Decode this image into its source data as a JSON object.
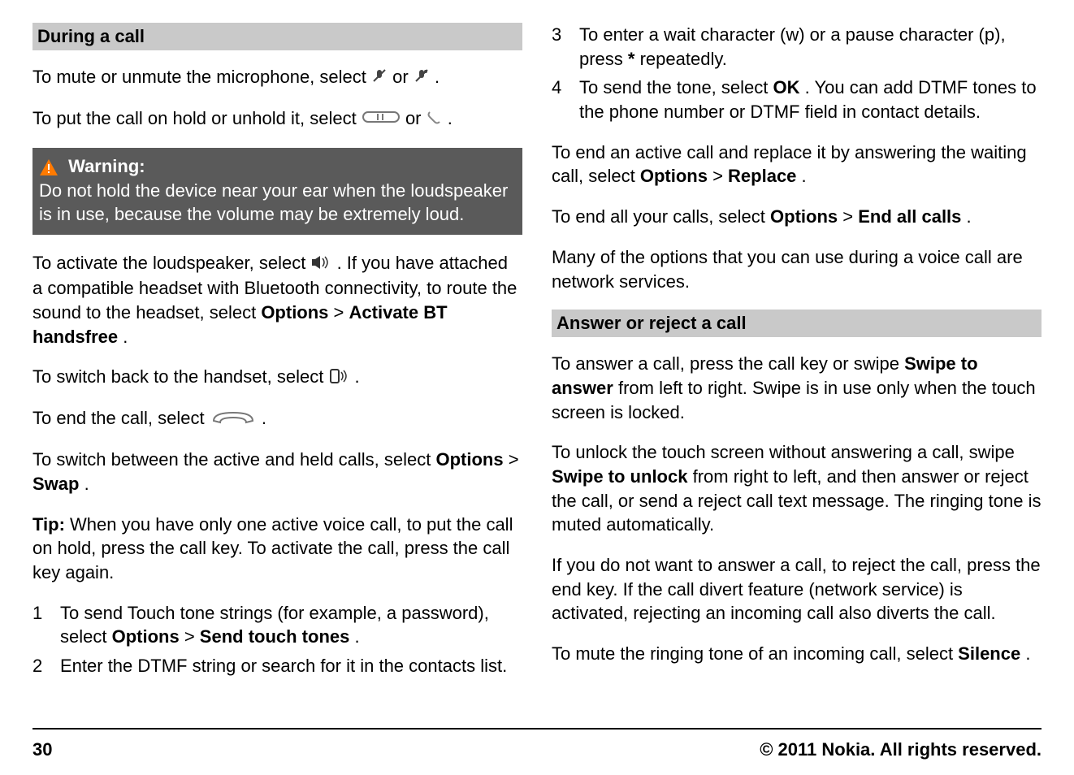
{
  "left": {
    "section_title": "During a call",
    "p1_a": "To mute or unmute the microphone, select ",
    "p1_or": " or ",
    "p1_end": ".",
    "p2_a": "To put the call on hold or unhold it, select ",
    "p2_or": " or ",
    "p2_end": ".",
    "warning_label": "Warning:",
    "warning_text": "Do not hold the device near your ear when the loudspeaker is in use, because the volume may be extremely loud.",
    "p3_a": "To activate the loudspeaker, select ",
    "p3_b": ". If you have attached a compatible headset with Bluetooth connectivity, to route the sound to the headset, select ",
    "p3_opt": "Options",
    "p3_gt": " > ",
    "p3_opt2": "Activate BT handsfree",
    "p3_end": ".",
    "p4_a": "To switch back to the handset, select ",
    "p4_end": ".",
    "p5_a": "To end the call, select ",
    "p5_end": ".",
    "p6_a": "To switch between the active and held calls, select ",
    "p6_opt": "Options",
    "p6_gt": " > ",
    "p6_opt2": "Swap",
    "p6_end": ".",
    "tip_label": "Tip: ",
    "tip_text": "When you have only one active voice call, to put the call on hold, press the call key. To activate the call, press the call key again.",
    "list": [
      {
        "n": "1",
        "a": "To send Touch tone strings (for example, a password), select ",
        "opt": "Options",
        "gt": " > ",
        "opt2": "Send touch tones",
        "end": "."
      },
      {
        "n": "2",
        "a": "Enter the DTMF string or search for it in the contacts list."
      }
    ]
  },
  "right": {
    "list": [
      {
        "n": "3",
        "a": "To enter a wait character (w) or a pause character (p), press ",
        "bold": "*",
        "end": " repeatedly."
      },
      {
        "n": "4",
        "a": "To send the tone, select ",
        "bold": "OK",
        "end": ". You can add DTMF tones to the phone number or DTMF field in contact details."
      }
    ],
    "p1_a": "To end an active call and replace it by answering the waiting call, select ",
    "p1_opt": "Options",
    "p1_gt": " > ",
    "p1_opt2": "Replace",
    "p1_end": ".",
    "p2_a": "To end all your calls, select ",
    "p2_opt": "Options",
    "p2_gt": " > ",
    "p2_opt2": "End all calls",
    "p2_end": ".",
    "p3": "Many of the options that you can use during a voice call are network services.",
    "section_title": "Answer or reject a call",
    "p4_a": "To answer a call, press the call key or swipe ",
    "p4_b": "Swipe to answer",
    "p4_c": " from left to right. Swipe is in use only when the touch screen is locked.",
    "p5_a": "To unlock the touch screen without answering a call, swipe ",
    "p5_b": "Swipe to unlock",
    "p5_c": " from right to left, and then answer or reject the call, or send a reject call text message. The ringing tone is muted automatically.",
    "p6": "If you do not want to answer a call, to reject the call, press the end key. If the call divert feature (network service) is activated, rejecting an incoming call also diverts the call.",
    "p7_a": "To mute the ringing tone of an incoming call, select ",
    "p7_b": "Silence",
    "p7_end": "."
  },
  "footer": {
    "page": "30",
    "copyright": "© 2011 Nokia. All rights reserved."
  }
}
